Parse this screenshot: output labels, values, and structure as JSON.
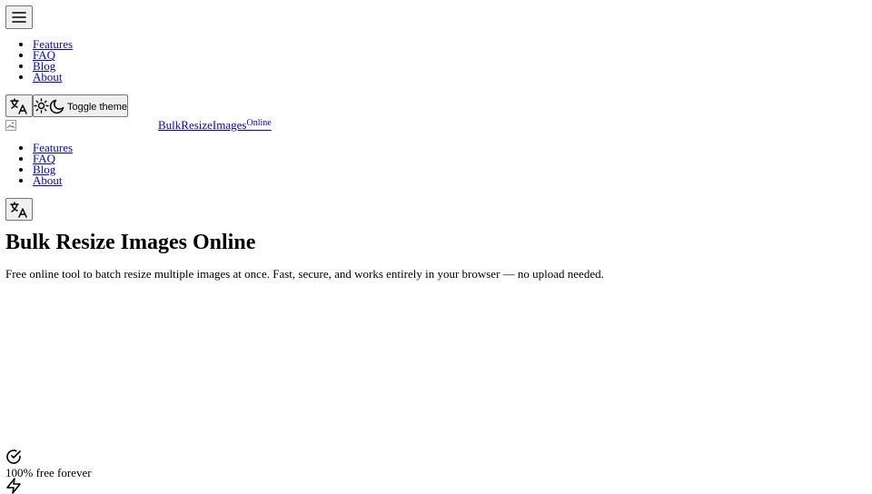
{
  "header": {
    "menu_icon": "hamburger-menu-icon",
    "nav_items": [
      {
        "label": "Features"
      },
      {
        "label": "FAQ"
      },
      {
        "label": "Blog"
      },
      {
        "label": "About"
      }
    ],
    "language_icon": "translate-icon",
    "theme_toggle": {
      "sun_icon": "sun-icon",
      "moon_icon": "moon-icon",
      "label": "Toggle theme"
    }
  },
  "brand": {
    "logo_alt": "",
    "name": "BulkResizeImages",
    "suffix": "Online"
  },
  "nav2": {
    "items": [
      {
        "label": "Features"
      },
      {
        "label": "FAQ"
      },
      {
        "label": "Blog"
      },
      {
        "label": "About"
      }
    ],
    "language_icon": "translate-icon"
  },
  "hero": {
    "title": "Bulk Resize Images Online",
    "subtitle": "Free online tool to batch resize multiple images at once. Fast, secure, and works entirely in your browser — no upload needed."
  },
  "features": [
    {
      "icon": "check-circle-icon",
      "text": "100% free forever"
    },
    {
      "icon": "lightning-icon",
      "text": ""
    }
  ],
  "colors": {
    "link": "#0000ee",
    "button_bg": "#efefef",
    "button_border": "#767676"
  }
}
